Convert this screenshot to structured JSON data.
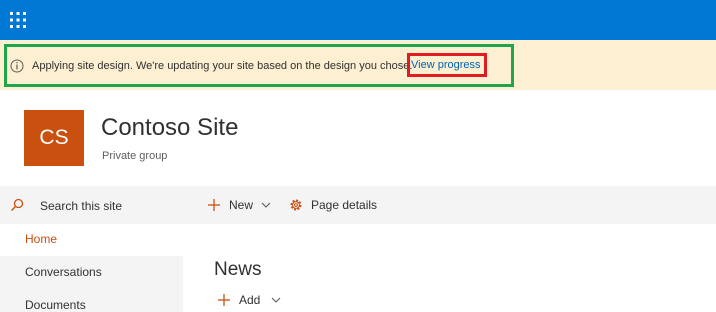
{
  "suite_bar": {
    "color": "#0078d4",
    "icon": "waffle-icon"
  },
  "notice": {
    "message": "Applying site design. We're updating your site based on the design you chose.",
    "link": "View progress",
    "background": "#fcefd2",
    "icon": "info-icon"
  },
  "site": {
    "logo_text": "CS",
    "logo_color": "#ca5010",
    "title": "Contoso Site",
    "subtitle": "Private group"
  },
  "left_nav": {
    "search_placeholder": "Search this site",
    "items": [
      {
        "label": "Home",
        "selected": true
      },
      {
        "label": "Conversations",
        "selected": false
      },
      {
        "label": "Documents",
        "selected": false
      }
    ]
  },
  "command_bar": {
    "new_label": "New",
    "page_details_label": "Page details"
  },
  "news": {
    "title": "News",
    "add_label": "Add"
  }
}
